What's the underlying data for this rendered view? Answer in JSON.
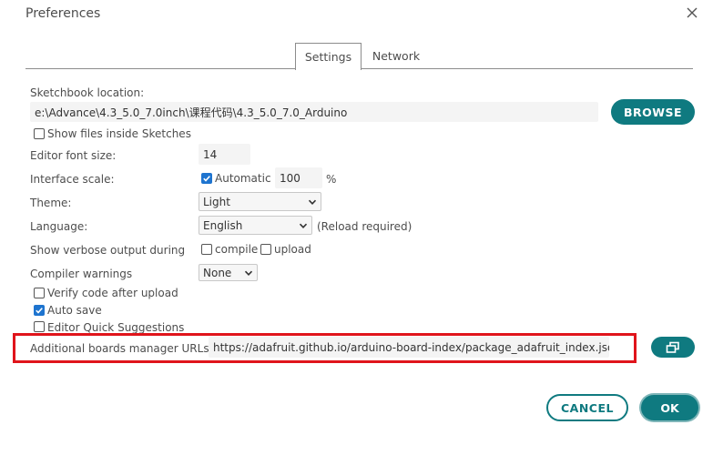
{
  "dialog": {
    "title": "Preferences"
  },
  "tabs": [
    {
      "label": "Settings",
      "active": true
    },
    {
      "label": "Network",
      "active": false
    }
  ],
  "sketchbook": {
    "label": "Sketchbook location:",
    "value": "e:\\Advance\\4.3_5.0_7.0inch\\课程代码\\4.3_5.0_7.0_Arduino",
    "browse_label": "BROWSE",
    "show_files_label": "Show files inside Sketches",
    "show_files_checked": false
  },
  "editor_font": {
    "label": "Editor font size:",
    "value": "14"
  },
  "interface_scale": {
    "label": "Interface scale:",
    "automatic_label": "Automatic",
    "automatic_checked": true,
    "value": "100",
    "unit": "%"
  },
  "theme": {
    "label": "Theme:",
    "selected": "Light"
  },
  "language": {
    "label": "Language:",
    "selected": "English",
    "note": "(Reload required)"
  },
  "verbose": {
    "label": "Show verbose output during",
    "compile_label": "compile",
    "compile_checked": false,
    "upload_label": "upload",
    "upload_checked": false
  },
  "compiler_warnings": {
    "label": "Compiler warnings",
    "selected": "None"
  },
  "options": {
    "verify_label": "Verify code after upload",
    "verify_checked": false,
    "autosave_label": "Auto save",
    "autosave_checked": true,
    "quick_suggestions_label": "Editor Quick Suggestions",
    "quick_suggestions_checked": false
  },
  "boards_manager": {
    "label": "Additional boards manager URLs:",
    "value": "https://adafruit.github.io/arduino-board-index/package_adafruit_index.json"
  },
  "footer": {
    "cancel_label": "CANCEL",
    "ok_label": "OK"
  },
  "colors": {
    "accent": "#0f7a80",
    "highlight": "#e0141b",
    "checkbox": "#1e74cf"
  }
}
